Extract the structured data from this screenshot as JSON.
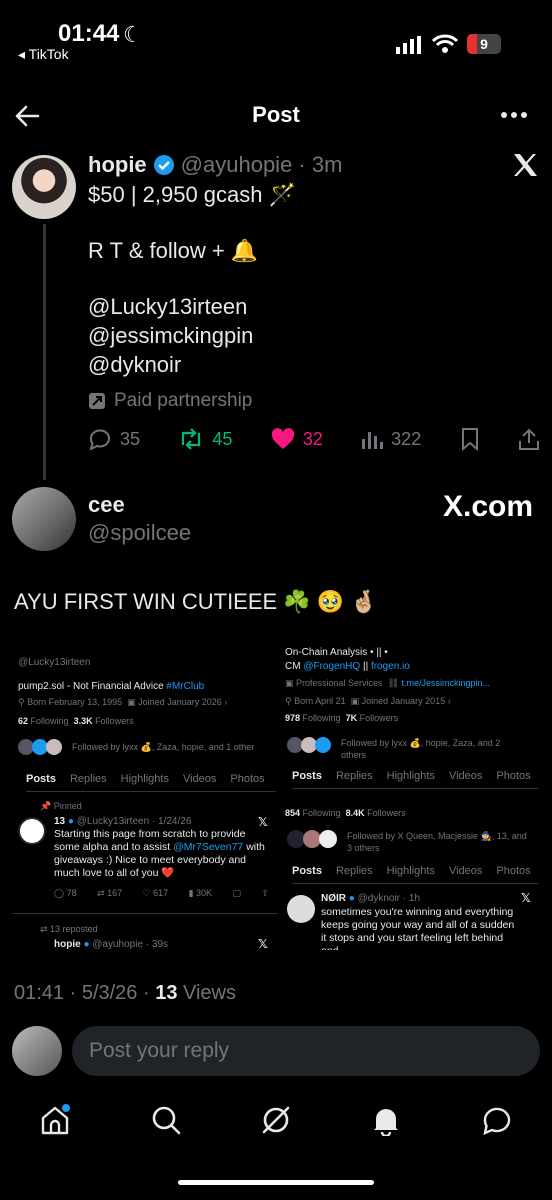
{
  "status_bar": {
    "time": "01:44",
    "back_app": "◂ TikTok",
    "battery": "9"
  },
  "header": {
    "title": "Post"
  },
  "post": {
    "name": "hopie",
    "handle": "@ayuhopie · 3m",
    "line1": "$50 | 2,950 gcash 🪄",
    "line2": "R T & follow + 🔔",
    "mentions": [
      "@Lucky13irteen",
      "@jessimckingpin",
      "@dyknoir"
    ],
    "paid": "Paid partnership",
    "replies": "35",
    "reposts": "45",
    "likes": "32",
    "views": "322"
  },
  "reply": {
    "name": "cee",
    "handle": "@spoilcee",
    "watermark": "X.com",
    "text": "AYU FIRST WIN CUTIEEE ☘️ 🥹 🤞🏼"
  },
  "shot_left": {
    "handle": "@Lucky13irteen",
    "bio_prefix": "pump2.sol - Not Financial Advice ",
    "bio_tag": "#MrClub",
    "born": "Born February 13, 1995",
    "joined": "Joined January 2026",
    "following_n": "62",
    "following_l": "Following",
    "followers_n": "3.3K",
    "followers_l": "Followers",
    "followed_by": "Followed by lyxx 💰, Zaza, hopie, and 1 other",
    "tabs": [
      "Posts",
      "Replies",
      "Highlights",
      "Videos",
      "Photos"
    ],
    "pinned": "Pinned",
    "tweet_name": "13",
    "tweet_meta": "@Lucky13irteen · 1/24/26",
    "tweet_text_a": "Starting this page from scratch to provide some alpha and to assist ",
    "tweet_mention": "@Mr7Seven77",
    "tweet_text_b": " with giveaways :) Nice to meet everybody and much love to all of you ❤️",
    "stats": [
      "78",
      "167",
      "617",
      "30K"
    ],
    "reposted": "13 reposted",
    "next_name": "hopie",
    "next_meta": "@ayuhopie · 39s"
  },
  "shot_right": {
    "line1": "On-Chain Analysis • || •",
    "line2_a": "CM ",
    "line2_b": "@FrogenHQ",
    "line2_c": " || ",
    "line2_d": "frogen.io",
    "services": "Professional Services",
    "link": "t.me/Jessimckingpin...",
    "born": "Born April 21",
    "joined": "Joined January 2015",
    "following_n": "978",
    "following_l": "Following",
    "followers_n": "7K",
    "followers_l": "Followers",
    "followed_by": "Followed by lyxx 💰, hopie, Zaza, and 2 others",
    "tabs": [
      "Posts",
      "Replies",
      "Highlights",
      "Videos",
      "Photos"
    ],
    "following2_n": "854",
    "following2_l": "Following",
    "followers2_n": "8.4K",
    "followers2_l": "Followers",
    "followed_by2": "Followed by X Queen, Macjessie 🧙, 13, and 3 others",
    "tweet_name": "NØIR",
    "tweet_meta": "@dyknoir · 1h",
    "tweet_text": "sometimes you're winning and everything keeps going your way and all of a sudden it stops and you start feeling left behind and"
  },
  "footer": {
    "time": "01:41 · 5/3/26 · ",
    "views_n": "13",
    "views_l": " Views"
  },
  "reply_input": {
    "placeholder": "Post your reply"
  },
  "colors": {
    "accent": "#1d9bf0",
    "like": "#f91880",
    "repost": "#00ba7c"
  }
}
